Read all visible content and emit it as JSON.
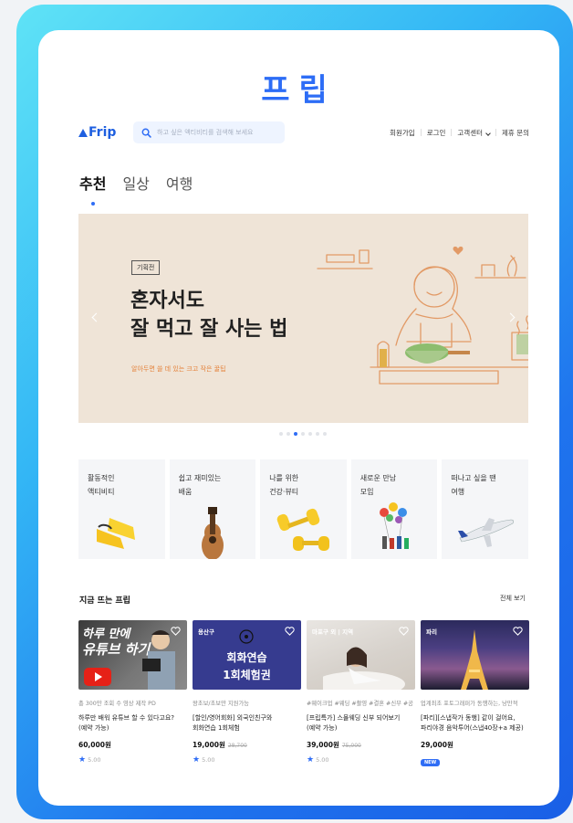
{
  "hero_title": "프립",
  "header": {
    "logo": "Frip",
    "search_placeholder": "하고 싶은 액티비티를 검색해 보세요",
    "links": [
      "회원가입",
      "로그인",
      "고객센터",
      "제휴 문의"
    ]
  },
  "tabs": [
    "추천",
    "일상",
    "여행"
  ],
  "banner": {
    "badge": "기획전",
    "title": "혼자서도\n잘 먹고 잘 사는 법",
    "subtitle": "알아두면 쓸 데 있는 크고 작은 꿀팁",
    "page_count": 7,
    "active_page": 3
  },
  "categories": [
    {
      "label": "활동적인\n액티비티",
      "icon": "flippers-icon"
    },
    {
      "label": "쉽고 재미있는\n배움",
      "icon": "ukulele-icon"
    },
    {
      "label": "나를 위한\n건강·뷰티",
      "icon": "dumbbell-icon"
    },
    {
      "label": "새로운 만남\n모임",
      "icon": "balloons-icon"
    },
    {
      "label": "떠나고 싶을 땐\n여행",
      "icon": "airplane-icon"
    }
  ],
  "section": {
    "title": "지금 뜨는 프립",
    "see_all": "전체 보기"
  },
  "products": [
    {
      "thumb_text_1": "하루 만에",
      "thumb_text_2": "유튜브 하기",
      "tags": "총 300만 조회 수 영상 제작 PD",
      "name": "하루만 배워 유튜브 할 수 있다고요?\n(예약 가능)",
      "price": "60,000원",
      "old_price": "",
      "rating": "5.00"
    },
    {
      "area": "용산구",
      "thumb_text_1": "회화연습",
      "thumb_text_2": "1회체험권",
      "tags": "왕초보/초보만 지원가능",
      "name": "[할인/영어회화] 외국인친구와\n회화연습 1회체험",
      "price": "19,000원",
      "old_price": "28,700",
      "rating": "5.00"
    },
    {
      "area": "마포구 외 | 지역",
      "tags": "#웨이크업 #웨딩 #촬영 #결혼 #신부 #공",
      "name": "[프립특가] 스몰웨딩 신부 되어보기\n(예약 가능)",
      "price": "39,000원",
      "old_price": "75,000",
      "rating": "5.00"
    },
    {
      "area": "파리",
      "tags": "업계최초 포토그래퍼가 동행하는, 낭만적",
      "name": "[파리][스냅작가 동행] 같이 걸어요,\n파리야경 음악투어(스냅40장+a 제공)",
      "price": "29,000원",
      "old_price": "",
      "badge": "NEW"
    }
  ],
  "colors": {
    "brand": "#2f6df5",
    "banner_bg": "#efe4d7",
    "accent_orange": "#e4823b"
  }
}
